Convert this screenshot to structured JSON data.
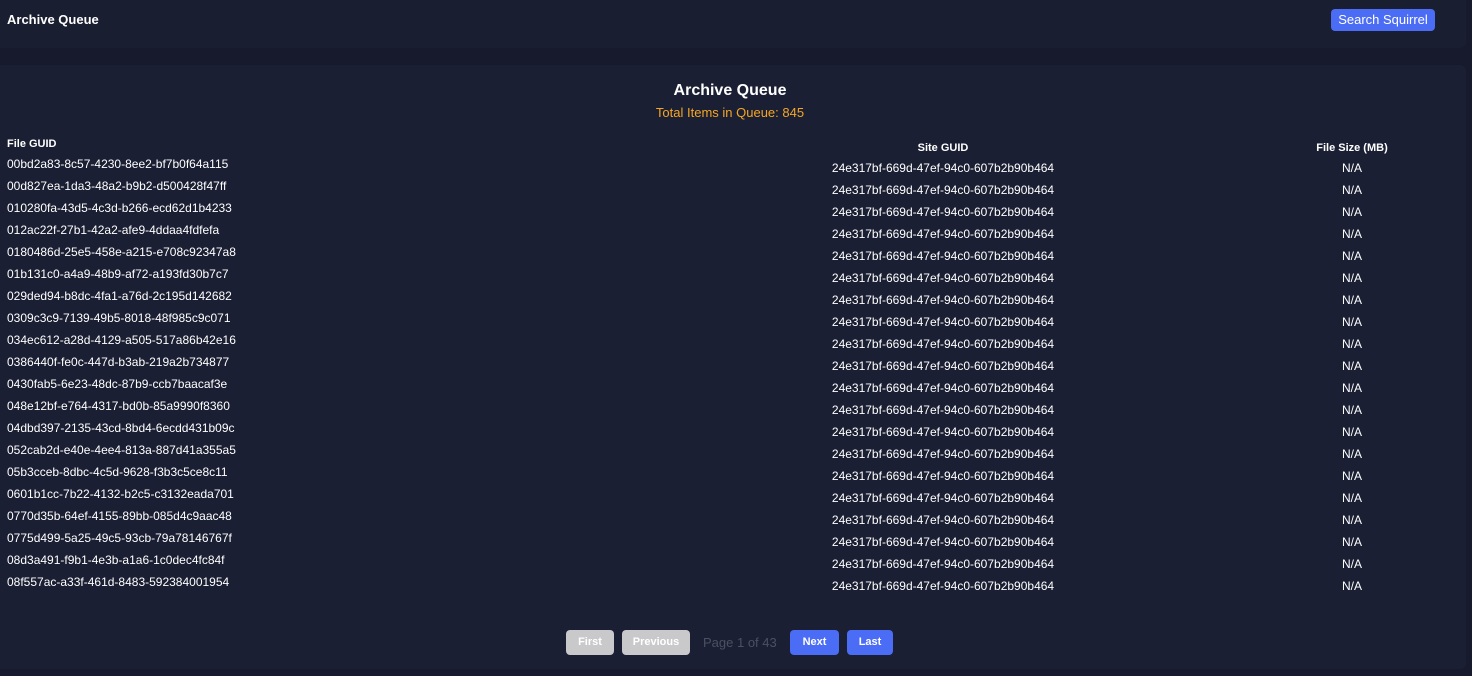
{
  "header": {
    "app_title": "Archive Queue",
    "search_button_label": "Search Squirrel"
  },
  "main": {
    "title": "Archive Queue",
    "queue_count_text": "Total Items in Queue: 845",
    "columns": {
      "file_guid": "File GUID",
      "site_guid": "Site GUID",
      "file_size": "File Size (MB)"
    },
    "rows": [
      {
        "file_guid": "00bd2a83-8c57-4230-8ee2-bf7b0f64a115",
        "site_guid": "24e317bf-669d-47ef-94c0-607b2b90b464",
        "file_size": "N/A"
      },
      {
        "file_guid": "00d827ea-1da3-48a2-b9b2-d500428f47ff",
        "site_guid": "24e317bf-669d-47ef-94c0-607b2b90b464",
        "file_size": "N/A"
      },
      {
        "file_guid": "010280fa-43d5-4c3d-b266-ecd62d1b4233",
        "site_guid": "24e317bf-669d-47ef-94c0-607b2b90b464",
        "file_size": "N/A"
      },
      {
        "file_guid": "012ac22f-27b1-42a2-afe9-4ddaa4fdfefa",
        "site_guid": "24e317bf-669d-47ef-94c0-607b2b90b464",
        "file_size": "N/A"
      },
      {
        "file_guid": "0180486d-25e5-458e-a215-e708c92347a8",
        "site_guid": "24e317bf-669d-47ef-94c0-607b2b90b464",
        "file_size": "N/A"
      },
      {
        "file_guid": "01b131c0-a4a9-48b9-af72-a193fd30b7c7",
        "site_guid": "24e317bf-669d-47ef-94c0-607b2b90b464",
        "file_size": "N/A"
      },
      {
        "file_guid": "029ded94-b8dc-4fa1-a76d-2c195d142682",
        "site_guid": "24e317bf-669d-47ef-94c0-607b2b90b464",
        "file_size": "N/A"
      },
      {
        "file_guid": "0309c3c9-7139-49b5-8018-48f985c9c071",
        "site_guid": "24e317bf-669d-47ef-94c0-607b2b90b464",
        "file_size": "N/A"
      },
      {
        "file_guid": "034ec612-a28d-4129-a505-517a86b42e16",
        "site_guid": "24e317bf-669d-47ef-94c0-607b2b90b464",
        "file_size": "N/A"
      },
      {
        "file_guid": "0386440f-fe0c-447d-b3ab-219a2b734877",
        "site_guid": "24e317bf-669d-47ef-94c0-607b2b90b464",
        "file_size": "N/A"
      },
      {
        "file_guid": "0430fab5-6e23-48dc-87b9-ccb7baacaf3e",
        "site_guid": "24e317bf-669d-47ef-94c0-607b2b90b464",
        "file_size": "N/A"
      },
      {
        "file_guid": "048e12bf-e764-4317-bd0b-85a9990f8360",
        "site_guid": "24e317bf-669d-47ef-94c0-607b2b90b464",
        "file_size": "N/A"
      },
      {
        "file_guid": "04dbd397-2135-43cd-8bd4-6ecdd431b09c",
        "site_guid": "24e317bf-669d-47ef-94c0-607b2b90b464",
        "file_size": "N/A"
      },
      {
        "file_guid": "052cab2d-e40e-4ee4-813a-887d41a355a5",
        "site_guid": "24e317bf-669d-47ef-94c0-607b2b90b464",
        "file_size": "N/A"
      },
      {
        "file_guid": "05b3cceb-8dbc-4c5d-9628-f3b3c5ce8c11",
        "site_guid": "24e317bf-669d-47ef-94c0-607b2b90b464",
        "file_size": "N/A"
      },
      {
        "file_guid": "0601b1cc-7b22-4132-b2c5-c3132eada701",
        "site_guid": "24e317bf-669d-47ef-94c0-607b2b90b464",
        "file_size": "N/A"
      },
      {
        "file_guid": "0770d35b-64ef-4155-89bb-085d4c9aac48",
        "site_guid": "24e317bf-669d-47ef-94c0-607b2b90b464",
        "file_size": "N/A"
      },
      {
        "file_guid": "0775d499-5a25-49c5-93cb-79a78146767f",
        "site_guid": "24e317bf-669d-47ef-94c0-607b2b90b464",
        "file_size": "N/A"
      },
      {
        "file_guid": "08d3a491-f9b1-4e3b-a1a6-1c0dec4fc84f",
        "site_guid": "24e317bf-669d-47ef-94c0-607b2b90b464",
        "file_size": "N/A"
      },
      {
        "file_guid": "08f557ac-a33f-461d-8483-592384001954",
        "site_guid": "24e317bf-669d-47ef-94c0-607b2b90b464",
        "file_size": "N/A"
      }
    ]
  },
  "pagination": {
    "first_label": "First",
    "previous_label": "Previous",
    "page_text": "Page 1 of 43",
    "next_label": "Next",
    "last_label": "Last"
  },
  "colors": {
    "accent": "#4b6cf5",
    "count_text": "#f5a623",
    "background": "#161a2c",
    "panel": "#1b1f33",
    "disabled_button": "#c9c9cc"
  }
}
